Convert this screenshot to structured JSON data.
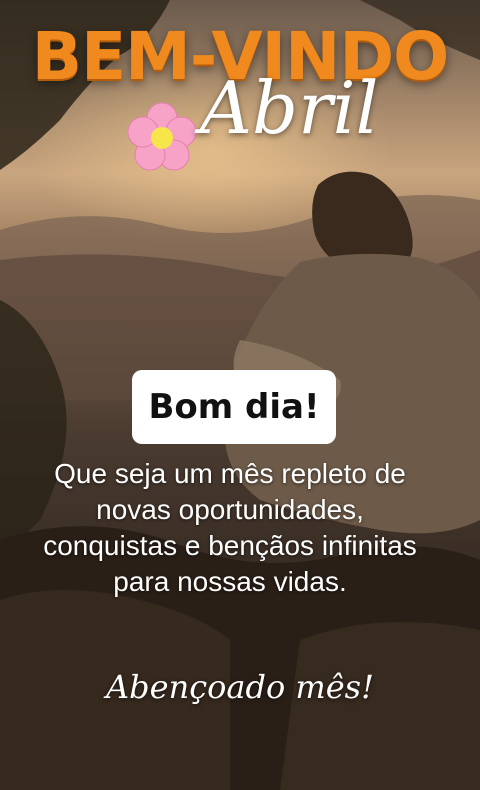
{
  "header": {
    "title": "BEM-VINDO",
    "month": "Abril"
  },
  "greeting": "Bom dia!",
  "message": "Que seja um mês repleto de novas oportunidades, conquistas e bençãos infinitas para nossas vidas.",
  "closing": "Abençoado mês!",
  "colors": {
    "title": "#f08a1e",
    "flower_petals": "#f7a3c8",
    "flower_center": "#f6e64a",
    "text": "#ffffff"
  },
  "icons": {
    "flower": "flower-icon"
  }
}
